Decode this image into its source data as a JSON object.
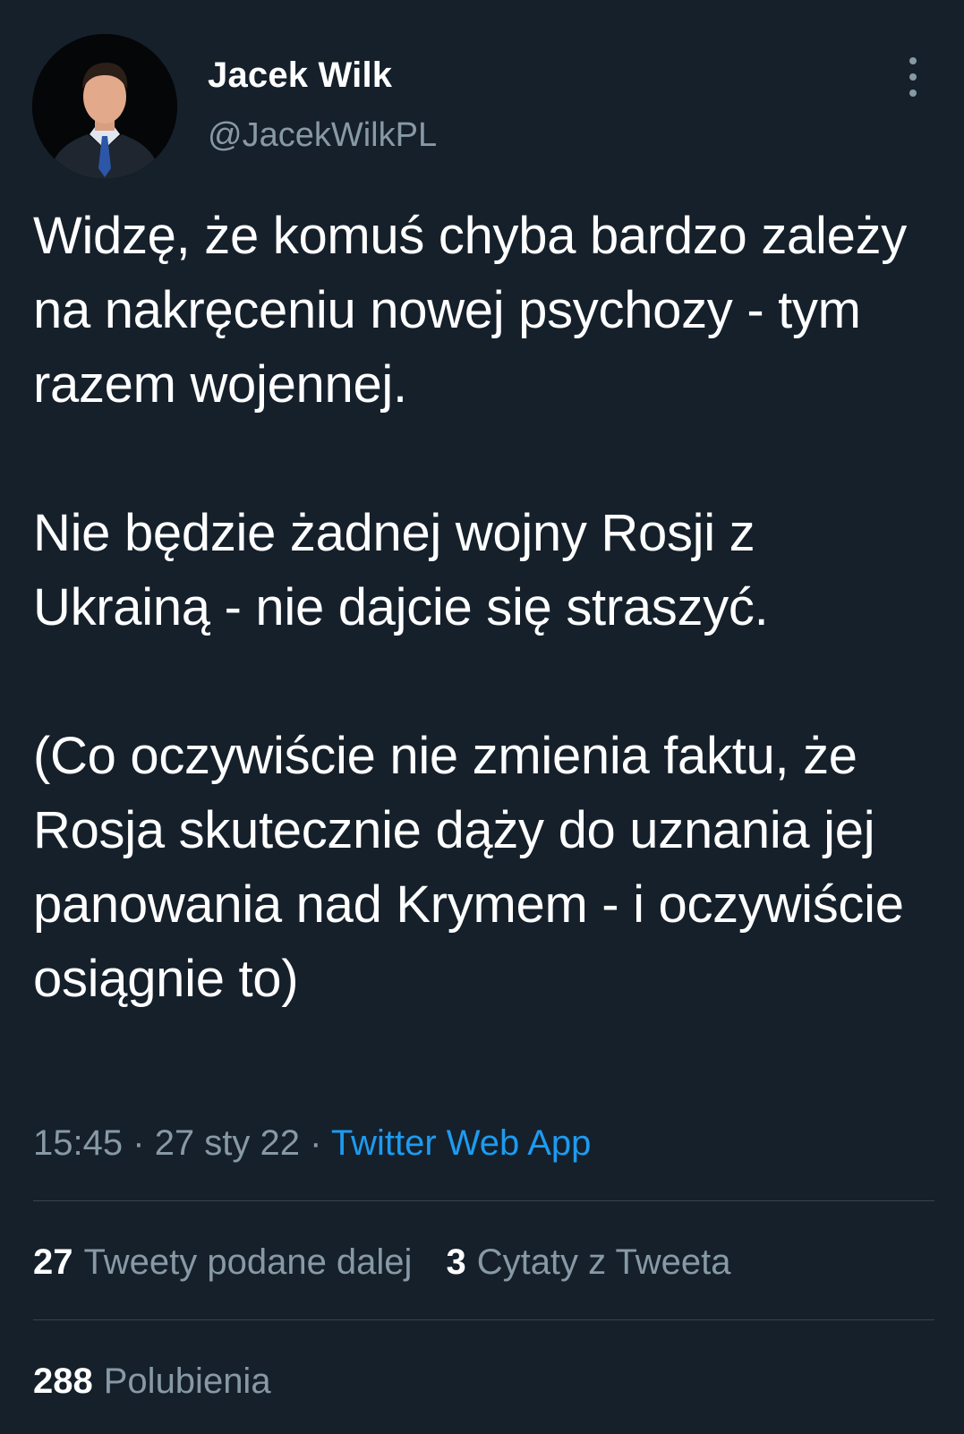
{
  "author": {
    "name": "Jacek Wilk",
    "handle": "@JacekWilkPL",
    "avatar_icon": "profile-photo"
  },
  "tweet": {
    "paragraphs": [
      "Widzę, że komuś chyba bardzo zależy na nakręceniu nowej psychozy - tym razem wojennej.",
      "Nie będzie żadnej wojny Rosji z Ukrainą - nie dajcie się straszyć.",
      "(Co oczywiście nie zmienia faktu, że Rosja skutecznie dąży do uznania jej panowania nad Krymem - i oczywiście osiągnie to)"
    ],
    "time": "15:45",
    "separator": "·",
    "date": "27 sty 22",
    "source": "Twitter Web App"
  },
  "stats": {
    "retweets": {
      "count": "27",
      "label": "Tweety podane dalej"
    },
    "quotes": {
      "count": "3",
      "label": "Cytaty z Tweeta"
    },
    "likes": {
      "count": "288",
      "label": "Polubienia"
    }
  },
  "colors": {
    "background": "#15202b",
    "text": "#ffffff",
    "secondary": "#8899a6",
    "link": "#1d9bf0",
    "divider": "#38444d"
  },
  "icons": {
    "more": "more-vertical-icon"
  }
}
